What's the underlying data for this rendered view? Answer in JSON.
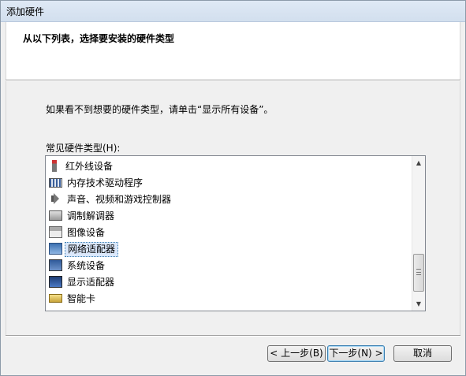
{
  "window": {
    "title": "添加硬件"
  },
  "header": {
    "heading": "从以下列表，选择要安装的硬件类型"
  },
  "content": {
    "instruction": "如果看不到想要的硬件类型，请单击“显示所有设备”。",
    "list_label": "常见硬件类型(H):"
  },
  "hardware_list": {
    "items": [
      {
        "label": "红外线设备",
        "icon": "infrared-icon"
      },
      {
        "label": "内存技术驱动程序",
        "icon": "memory-icon"
      },
      {
        "label": "声音、视频和游戏控制器",
        "icon": "speaker-icon"
      },
      {
        "label": "调制解调器",
        "icon": "modem-icon"
      },
      {
        "label": "图像设备",
        "icon": "imaging-icon"
      },
      {
        "label": "网络适配器",
        "icon": "network-icon",
        "selected": true
      },
      {
        "label": "系统设备",
        "icon": "system-icon"
      },
      {
        "label": "显示适配器",
        "icon": "display-icon"
      },
      {
        "label": "智能卡",
        "icon": "smartcard-icon"
      }
    ],
    "scroll_up_glyph": "▲",
    "scroll_down_glyph": "▼"
  },
  "buttons": {
    "back": "< 上一步(B)",
    "next": "下一步(N) >",
    "cancel": "取消"
  },
  "colors": {
    "selection_bg": "#dbe8fb",
    "selection_border": "#3c7fb1"
  }
}
